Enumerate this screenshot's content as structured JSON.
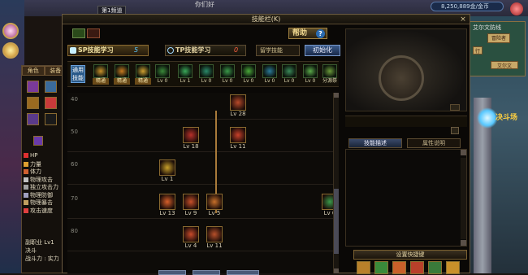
{
  "window": {
    "title": "技能栏(K)",
    "help_label": "帮助",
    "help_icon": "?",
    "close_icon": "×"
  },
  "tabs": {
    "sp_label": "SP技能学习",
    "sp_value": "5",
    "tp_label": "TP技能学习",
    "tp_value": "0",
    "learned_select": "留学技能",
    "init_button": "初始化"
  },
  "skill_bar": {
    "first_label": "通用\n技能",
    "items": [
      {
        "label": "精通",
        "tag": true,
        "color": "#c8902a"
      },
      {
        "label": "精通",
        "tag": true,
        "color": "#c87a20"
      },
      {
        "label": "精通",
        "tag": true,
        "color": "#d0a030"
      },
      {
        "label": "Lv 0",
        "tag": false,
        "color": "#3a8a3a"
      },
      {
        "label": "Lv 1",
        "tag": false,
        "color": "#3aaa5a"
      },
      {
        "label": "Lv 0",
        "tag": false,
        "color": "#2a8a6a"
      },
      {
        "label": "Lv 0",
        "tag": false,
        "color": "#3a9a4a"
      },
      {
        "label": "Lv 0",
        "tag": false,
        "color": "#4aaa3a"
      },
      {
        "label": "Lv 0",
        "tag": false,
        "color": "#2a7a9a"
      },
      {
        "label": "Lv 0",
        "tag": false,
        "color": "#3a8a5a"
      },
      {
        "label": "Lv 0",
        "tag": false,
        "color": "#5aaa4a"
      },
      {
        "label": "分源祭",
        "tag": false,
        "color": "#6a9a3a"
      }
    ]
  },
  "tree": {
    "row_labels": [
      "40",
      "50",
      "60",
      "70",
      "80"
    ],
    "nodes": [
      {
        "level": "Lv 28",
        "color": "#b84a2a"
      },
      {
        "level": "Lv 18",
        "color": "#b8302a"
      },
      {
        "level": "Lv 11",
        "color": "#c8402a"
      },
      {
        "level": "Lv 1",
        "color": "#c8a02a"
      },
      {
        "level": "Lv 13",
        "color": "#d8602a"
      },
      {
        "level": "Lv 9",
        "color": "#c8502a"
      },
      {
        "level": "Lv 5",
        "color": "#c8702a"
      },
      {
        "level": "Lv 0",
        "color": "#3a9a4a"
      },
      {
        "level": "Lv 4",
        "color": "#c84a2a"
      },
      {
        "level": "Lv 11",
        "color": "#b8502a"
      }
    ]
  },
  "right_pane": {
    "tab_desc": "技能描述",
    "tab_attr": "属性说明",
    "set_key_label": "设置快捷键"
  },
  "game_hud": {
    "top_label": "第1频道",
    "top_text": "你们好",
    "gold_text": "8,250,889金/金币",
    "npc_label": "决斗场",
    "minimap_title": "艾尔文防线",
    "minimap_cells": [
      "冒险者",
      "艾尔文",
      "行"
    ]
  },
  "character_panel": {
    "tabs": [
      "角色",
      "装备"
    ],
    "stats": [
      {
        "label": "HP",
        "color": "#e03030"
      },
      {
        "label": "力量",
        "color": "#e0a030"
      },
      {
        "label": "体力",
        "color": "#d06030"
      },
      {
        "label": "物理攻击",
        "color": "#c0c0c0"
      },
      {
        "label": "独立攻击力",
        "color": "#a0a0a0"
      },
      {
        "label": "物理防御",
        "color": "#a0a0c0"
      },
      {
        "label": "物理暴击",
        "color": "#c0a060"
      },
      {
        "label": "攻击速度",
        "color": "#e04040"
      }
    ],
    "sub_job": "副职业",
    "sub_job_value": "Lv1",
    "duel": "决斗",
    "power": "战斗力 : 实力"
  }
}
